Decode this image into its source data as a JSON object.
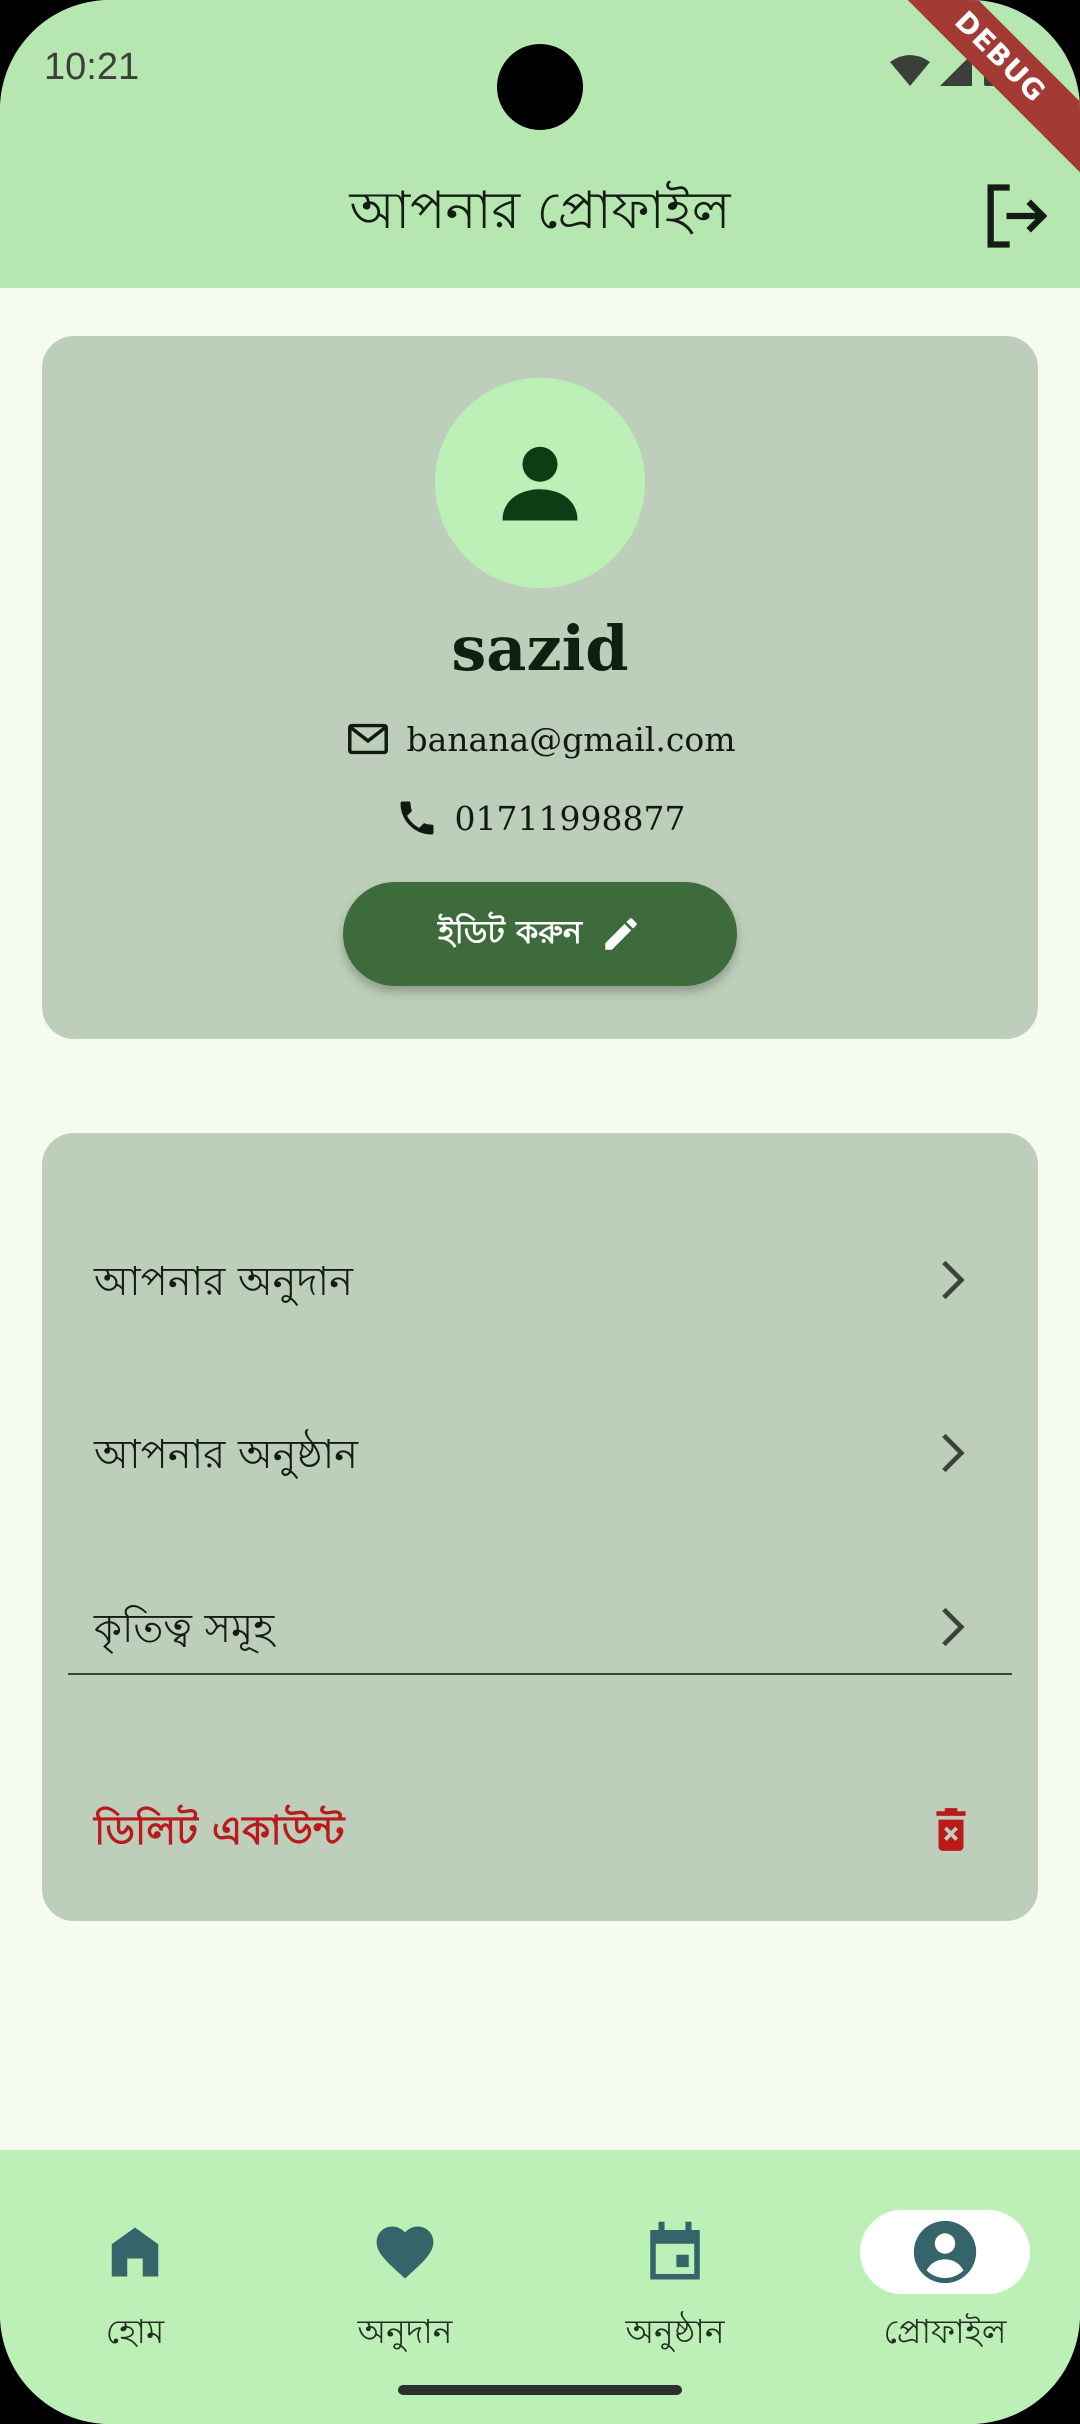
{
  "status_bar": {
    "time": "10:21",
    "debug_label": "DEBUG"
  },
  "app_bar": {
    "title": "আপনার প্রোফাইল",
    "logout_icon": "logout-icon"
  },
  "profile": {
    "name": "sazid",
    "email": "banana@gmail.com",
    "phone": "01711998877",
    "edit_label": "ইডিট করুন",
    "avatar_icon": "person-icon"
  },
  "menu": {
    "items": [
      {
        "label": "আপনার অনুদান"
      },
      {
        "label": "আপনার অনুষ্ঠান"
      },
      {
        "label": "কৃতিত্ব সমূহ"
      }
    ],
    "delete_label": "ডিলিট একাউন্ট"
  },
  "bottom_nav": {
    "items": [
      {
        "label": "হোম",
        "icon": "home-icon"
      },
      {
        "label": "অনুদান",
        "icon": "heart-icon"
      },
      {
        "label": "অনুষ্ঠান",
        "icon": "calendar-icon"
      },
      {
        "label": "প্রোফাইল",
        "icon": "account-circle-icon"
      }
    ],
    "active_index": 3
  },
  "colors": {
    "app_bar_bg": "#b7e7b0",
    "card_bg": "#bdcfba",
    "primary_button": "#3e6b3b",
    "danger": "#ba1a1a",
    "nav_bg": "#bdf0b6",
    "nav_icon": "#35646a"
  }
}
